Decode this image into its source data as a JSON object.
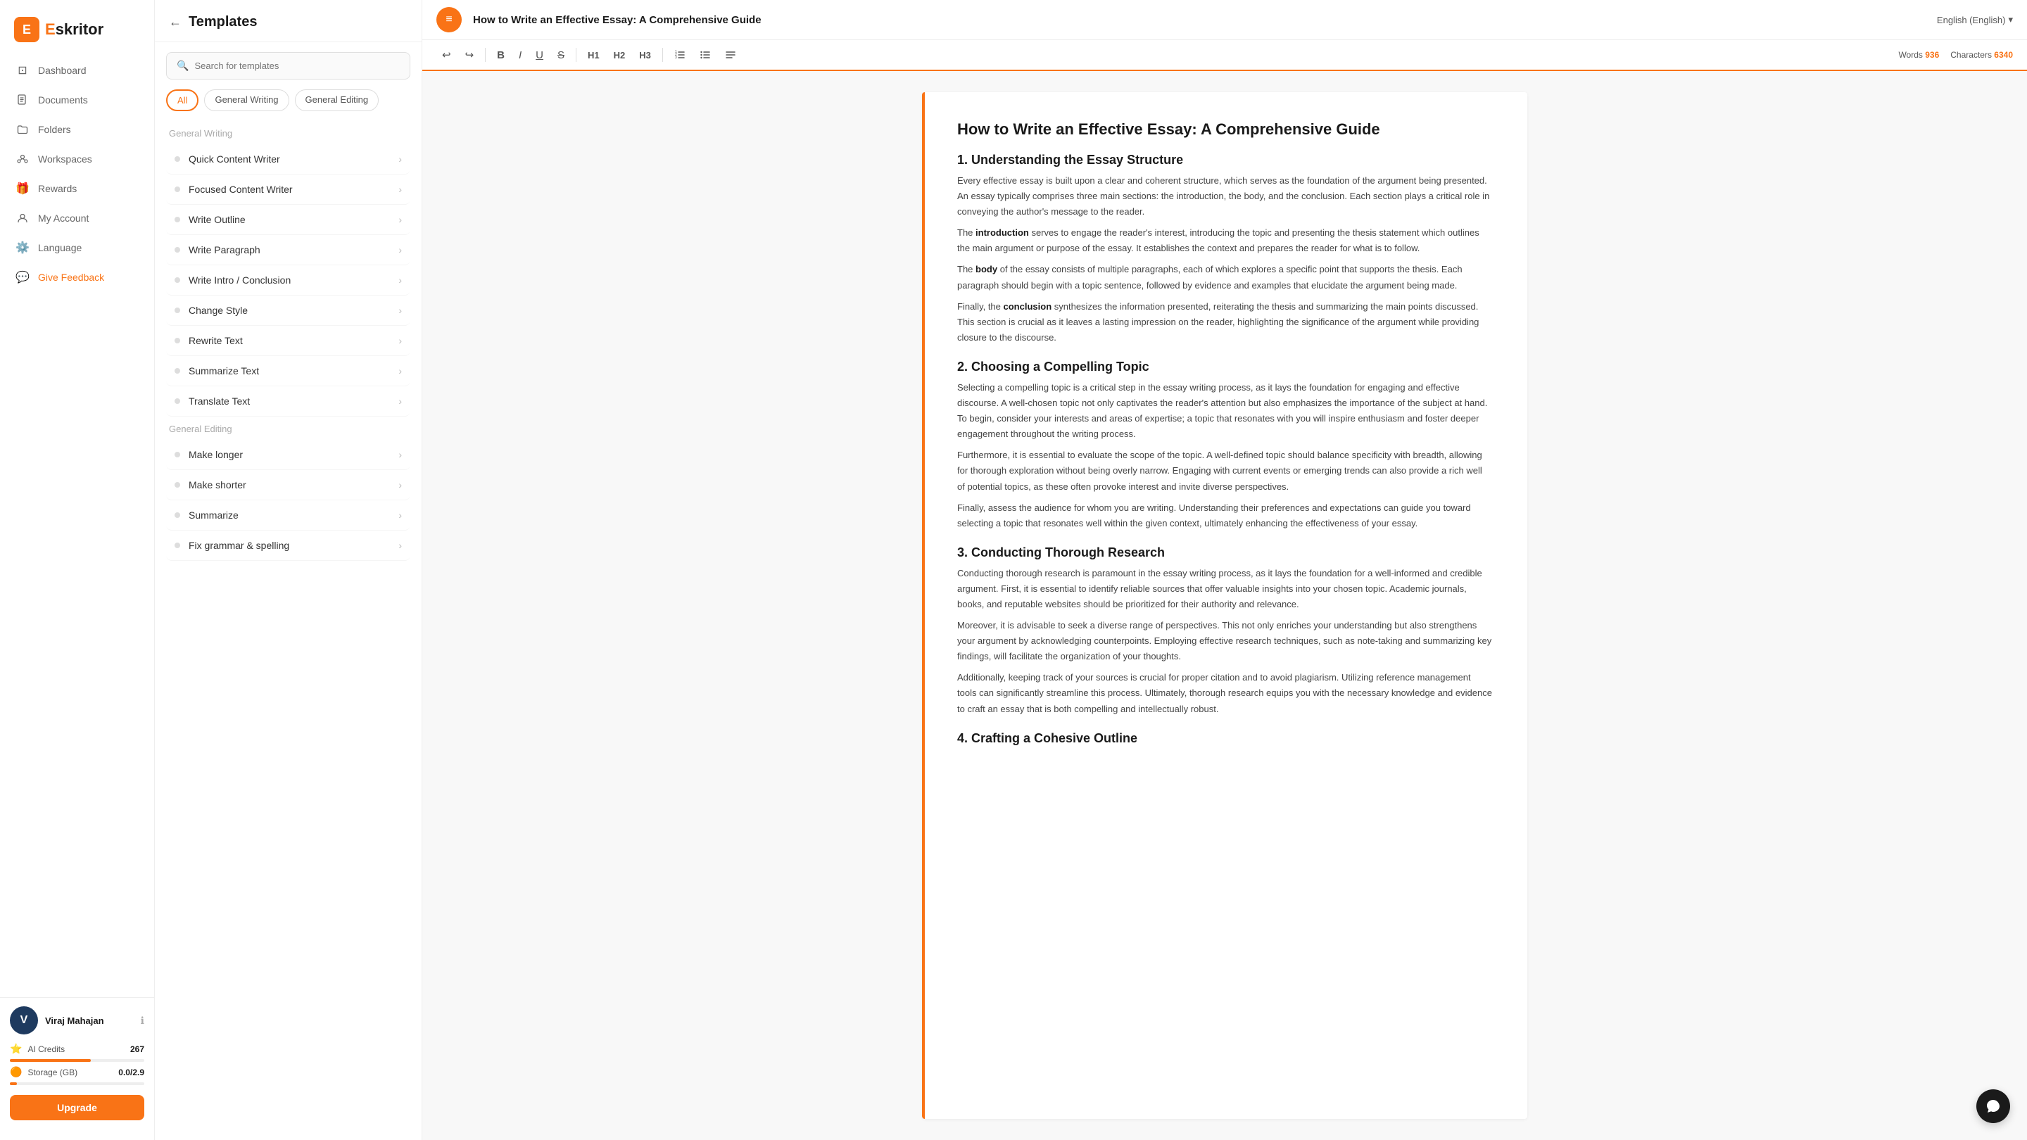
{
  "sidebar": {
    "logo_letter": "E",
    "logo_name": "skritor",
    "nav_items": [
      {
        "id": "dashboard",
        "label": "Dashboard",
        "icon": "⊡"
      },
      {
        "id": "documents",
        "label": "Documents",
        "icon": "📄"
      },
      {
        "id": "folders",
        "label": "Folders",
        "icon": "📁"
      },
      {
        "id": "workspaces",
        "label": "Workspaces",
        "icon": "👥"
      },
      {
        "id": "rewards",
        "label": "Rewards",
        "icon": "🎁"
      },
      {
        "id": "my-account",
        "label": "My Account",
        "icon": "👤"
      },
      {
        "id": "language",
        "label": "Language",
        "icon": "⚙️"
      },
      {
        "id": "give-feedback",
        "label": "Give Feedback",
        "icon": "💬"
      }
    ],
    "user": {
      "initial": "V",
      "name": "Viraj Mahajan"
    },
    "credits_label": "AI Credits",
    "credits_count": "267",
    "storage_label": "Storage (GB)",
    "storage_value": "0.0/2.9",
    "upgrade_label": "Upgrade"
  },
  "templates": {
    "title": "Templates",
    "search_placeholder": "Search for templates",
    "filter_tabs": [
      {
        "label": "All",
        "active": true
      },
      {
        "label": "General Writing",
        "active": false
      },
      {
        "label": "General Editing",
        "active": false
      }
    ],
    "sections": [
      {
        "label": "General Writing",
        "items": [
          "Quick Content Writer",
          "Focused Content Writer",
          "Write Outline",
          "Write Paragraph",
          "Write Intro / Conclusion",
          "Change Style",
          "Rewrite Text",
          "Summarize Text",
          "Translate Text"
        ]
      },
      {
        "label": "General Editing",
        "items": [
          "Make longer",
          "Make shorter",
          "Summarize",
          "Fix grammar & spelling"
        ]
      }
    ]
  },
  "editor": {
    "doc_icon": "≡",
    "doc_title": "How to Write an Effective Essay: A Comprehensive Guide",
    "language": "English (English)",
    "language_arrow": "▾",
    "toolbar": {
      "undo": "↩",
      "redo": "↪",
      "bold": "B",
      "italic": "I",
      "underline": "U",
      "strikethrough": "S",
      "h1": "H1",
      "h2": "H2",
      "h3": "H3",
      "ordered_list": "≡",
      "unordered_list": "≡",
      "align": "≡"
    },
    "word_count_label": "Words",
    "word_count": "936",
    "char_count_label": "Characters",
    "char_count": "6340",
    "content": {
      "main_title": "How to Write an Effective Essay: A Comprehensive Guide",
      "sections": [
        {
          "heading": "1. Understanding the Essay Structure",
          "paragraphs": [
            "Every effective essay is built upon a clear and coherent structure, which serves as the foundation of the argument being presented. An essay typically comprises three main sections: the introduction, the body, and the conclusion. Each section plays a critical role in conveying the author's message to the reader.",
            "The introduction serves to engage the reader's interest, introducing the topic and presenting the thesis statement which outlines the main argument or purpose of the essay. It establishes the context and prepares the reader for what is to follow.",
            "The body of the essay consists of multiple paragraphs, each of which explores a specific point that supports the thesis. Each paragraph should begin with a topic sentence, followed by evidence and examples that elucidate the argument being made.",
            "Finally, the conclusion synthesizes the information presented, reiterating the thesis and summarizing the main points discussed. This section is crucial as it leaves a lasting impression on the reader, highlighting the significance of the argument while providing closure to the discourse."
          ],
          "bold_words": [
            "introduction",
            "body",
            "conclusion"
          ]
        },
        {
          "heading": "2. Choosing a Compelling Topic",
          "paragraphs": [
            "Selecting a compelling topic is a critical step in the essay writing process, as it lays the foundation for engaging and effective discourse. A well-chosen topic not only captivates the reader's attention but also emphasizes the importance of the subject at hand. To begin, consider your interests and areas of expertise; a topic that resonates with you will inspire enthusiasm and foster deeper engagement throughout the writing process.",
            "Furthermore, it is essential to evaluate the scope of the topic. A well-defined topic should balance specificity with breadth, allowing for thorough exploration without being overly narrow. Engaging with current events or emerging trends can also provide a rich well of potential topics, as these often provoke interest and invite diverse perspectives.",
            "Finally, assess the audience for whom you are writing. Understanding their preferences and expectations can guide you toward selecting a topic that resonates well within the given context, ultimately enhancing the effectiveness of your essay."
          ]
        },
        {
          "heading": "3. Conducting Thorough Research",
          "paragraphs": [
            "Conducting thorough research is paramount in the essay writing process, as it lays the foundation for a well-informed and credible argument. First, it is essential to identify reliable sources that offer valuable insights into your chosen topic. Academic journals, books, and reputable websites should be prioritized for their authority and relevance.",
            "Moreover, it is advisable to seek a diverse range of perspectives. This not only enriches your understanding but also strengthens your argument by acknowledging counterpoints. Employing effective research techniques, such as note-taking and summarizing key findings, will facilitate the organization of your thoughts.",
            "Additionally, keeping track of your sources is crucial for proper citation and to avoid plagiarism. Utilizing reference management tools can significantly streamline this process. Ultimately, thorough research equips you with the necessary knowledge and evidence to craft an essay that is both compelling and intellectually robust."
          ]
        },
        {
          "heading": "4. Crafting a Cohesive Outline",
          "paragraphs": []
        }
      ]
    }
  }
}
